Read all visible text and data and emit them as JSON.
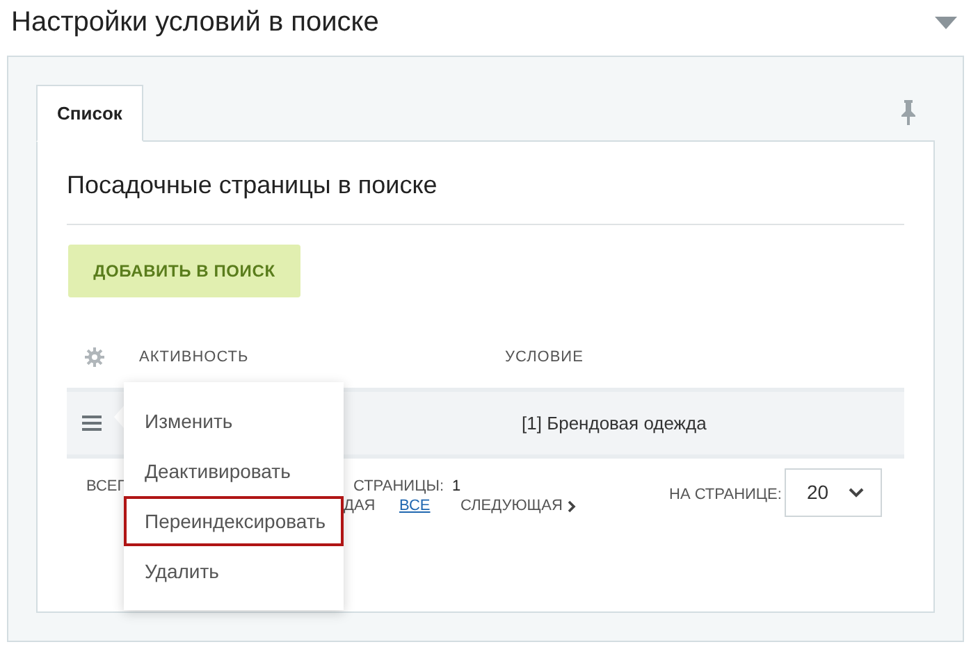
{
  "title": "Настройки условий в поиске",
  "tabs": [
    {
      "label": "Список",
      "selected": true
    }
  ],
  "section_title": "Посадочные страницы в поиске",
  "add_button": "ДОБАВИТЬ В ПОИСК",
  "table": {
    "columns": [
      "АКТИВНОСТЬ",
      "УСЛОВИЕ"
    ],
    "rows": [
      {
        "cells": [
          "",
          "[1] Брендовая одежда"
        ],
        "selected": true
      }
    ]
  },
  "footer": {
    "total": "ВСЕГ",
    "pages_label": "СТРАНИЦЫ:",
    "pages": "1",
    "prev": "ДАЯ",
    "all": "ВСЕ",
    "next": "СЛЕДУЮЩАЯ",
    "per_page_label": "НА СТРАНИЦЕ:",
    "per_page": "20"
  },
  "context_menu": [
    {
      "label": "Изменить",
      "highlighted": false
    },
    {
      "label": "Деактивировать",
      "highlighted": false
    },
    {
      "label": "Переиндексировать",
      "highlighted": true
    },
    {
      "label": "Удалить",
      "highlighted": false
    }
  ]
}
